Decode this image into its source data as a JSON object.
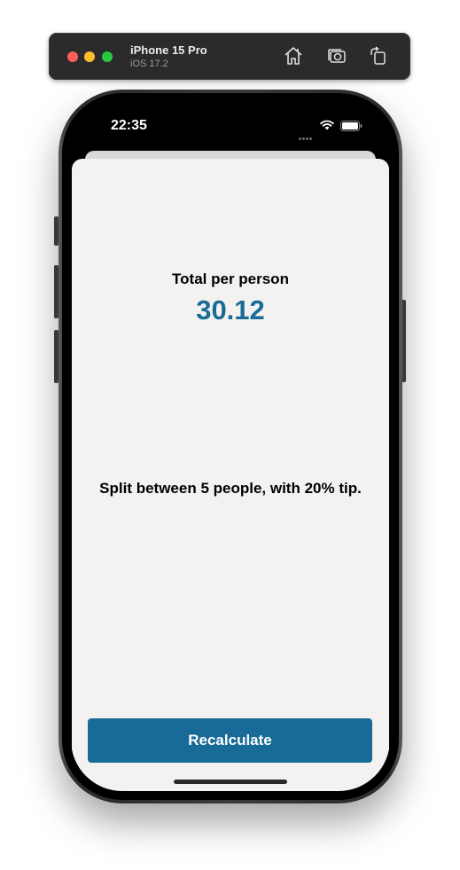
{
  "simulator": {
    "device_name": "iPhone 15 Pro",
    "os_version": "iOS 17.2",
    "icons": [
      "home-icon",
      "screenshot-icon",
      "rotate-icon"
    ]
  },
  "status_bar": {
    "time": "22:35",
    "icons": [
      "wifi-icon",
      "battery-icon"
    ]
  },
  "app": {
    "total_label": "Total per person",
    "total_value": "30.12",
    "split_summary": "Split between 5 people, with 20% tip.",
    "recalculate_label": "Recalculate"
  },
  "colors": {
    "accent": "#176b96",
    "total_value": "#1a6b96",
    "sheet_background": "#f3f2f0"
  }
}
